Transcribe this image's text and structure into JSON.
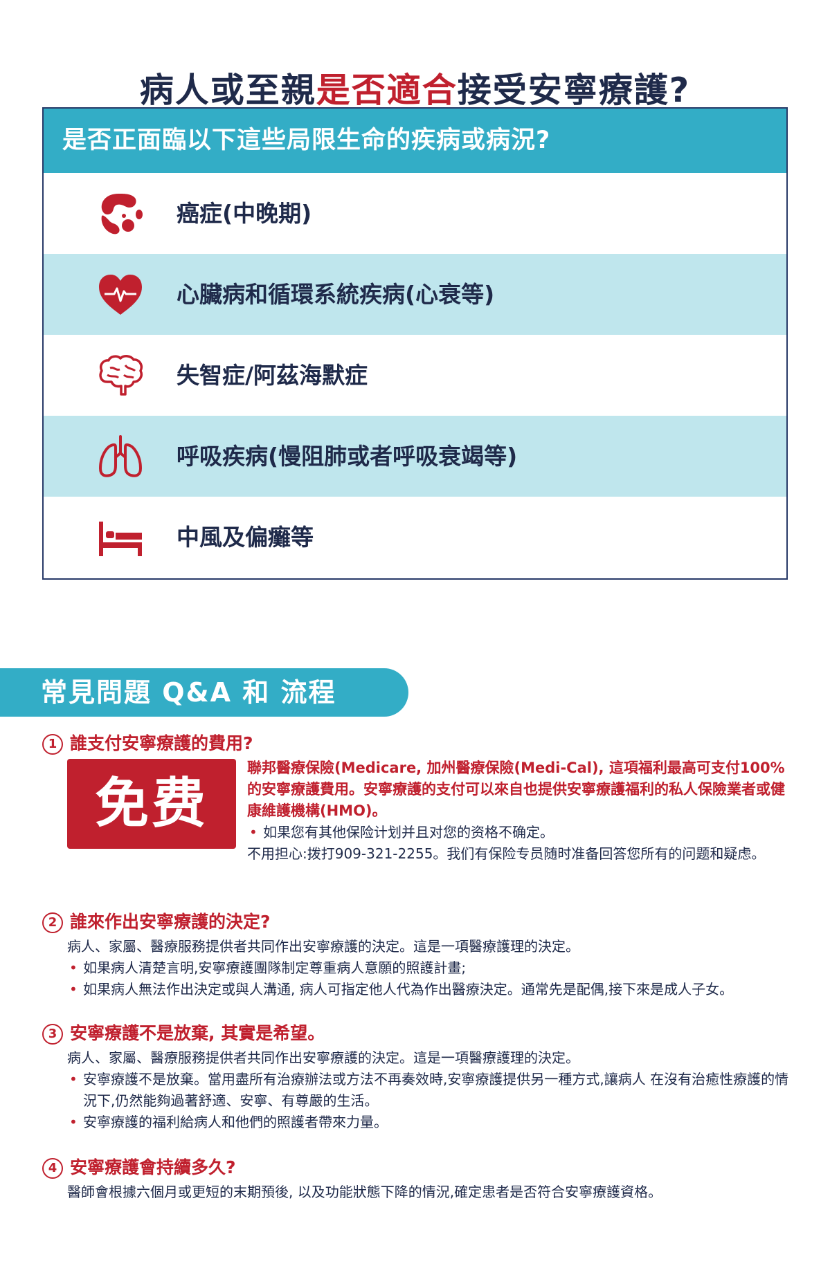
{
  "title": {
    "part1": "病人或至親",
    "highlight": "是否適合",
    "part2": "接受安寧療護?"
  },
  "conditions": {
    "header": "是否正面臨以下這些局限生命的疾病或病況?",
    "items": [
      {
        "icon": "cancer-cells-icon",
        "label": "癌症(中晚期)"
      },
      {
        "icon": "heart-pulse-icon",
        "label": "心臟病和循環系統疾病(心衰等)"
      },
      {
        "icon": "brain-icon",
        "label": "失智症/阿茲海默症"
      },
      {
        "icon": "lungs-icon",
        "label": "呼吸疾病(慢阻肺或者呼吸衰竭等)"
      },
      {
        "icon": "bed-icon",
        "label": "中風及偏癱等"
      }
    ]
  },
  "faq": {
    "tab_label": "常見問題 Q&A 和 流程",
    "q1": {
      "num": "1",
      "question": "誰支付安寧療護的費用?",
      "badge": "免费",
      "answer_bold": "聯邦醫療保險(Medicare, 加州醫療保險(Medi-Cal), 這項福利最高可支付100%的安寧療護費用。安寧療護的支付可以來自也提供安寧療護福利的私人保險業者或健康維護機構(HMO)。",
      "bullet": "如果您有其他保险计划并且对您的资格不确定。",
      "note": "不用担心:拨打909-321-2255。我们有保险专员随时准备回答您所有的问题和疑虑。"
    },
    "q2": {
      "num": "2",
      "question": "誰來作出安寧療護的決定?",
      "intro": "病人、家屬、醫療服務提供者共同作出安寧療護的決定。這是一項醫療護理的決定。",
      "bullets": [
        "如果病人清楚言明,安寧療護團隊制定尊重病人意願的照護計畫;",
        "如果病人無法作出決定或與人溝通, 病人可指定他人代為作出醫療決定。通常先是配偶,接下來是成人子女。"
      ]
    },
    "q3": {
      "num": "3",
      "question": "安寧療護不是放棄, 其實是希望。",
      "intro": "病人、家屬、醫療服務提供者共同作出安寧療護的決定。這是一項醫療護理的決定。",
      "bullets": [
        "安寧療護不是放棄。當用盡所有治療辦法或方法不再奏效時,安寧療護提供另一種方式,讓病人 在沒有治癒性療護的情況下,仍然能夠過著舒適、安寧、有尊嚴的生活。",
        "安寧療護的福利給病人和他們的照護者帶來力量。"
      ]
    },
    "q4": {
      "num": "4",
      "question": "安寧療護會持續多久?",
      "answer": "醫師會根據六個月或更短的末期預後, 以及功能狀態下降的情況,確定患者是否符合安寧療護資格。"
    }
  },
  "colors": {
    "navy": "#1f2a4a",
    "red": "#c0202e",
    "teal": "#33adc6",
    "light_teal": "#bfe6ed"
  }
}
